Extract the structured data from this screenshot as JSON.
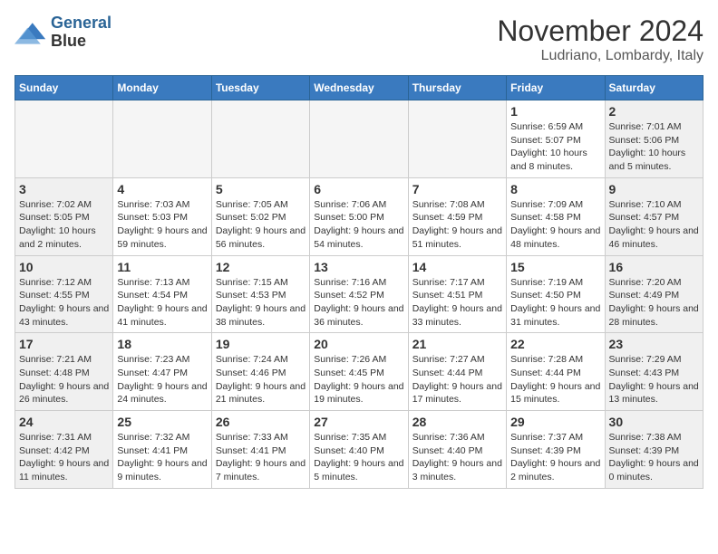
{
  "logo": {
    "line1": "General",
    "line2": "Blue"
  },
  "header": {
    "month": "November 2024",
    "location": "Ludriano, Lombardy, Italy"
  },
  "weekdays": [
    "Sunday",
    "Monday",
    "Tuesday",
    "Wednesday",
    "Thursday",
    "Friday",
    "Saturday"
  ],
  "weeks": [
    [
      {
        "day": "",
        "empty": true
      },
      {
        "day": "",
        "empty": true
      },
      {
        "day": "",
        "empty": true
      },
      {
        "day": "",
        "empty": true
      },
      {
        "day": "",
        "empty": true
      },
      {
        "day": "1",
        "sunrise": "Sunrise: 6:59 AM",
        "sunset": "Sunset: 5:07 PM",
        "daylight": "Daylight: 10 hours and 8 minutes."
      },
      {
        "day": "2",
        "sunrise": "Sunrise: 7:01 AM",
        "sunset": "Sunset: 5:06 PM",
        "daylight": "Daylight: 10 hours and 5 minutes."
      }
    ],
    [
      {
        "day": "3",
        "sunrise": "Sunrise: 7:02 AM",
        "sunset": "Sunset: 5:05 PM",
        "daylight": "Daylight: 10 hours and 2 minutes."
      },
      {
        "day": "4",
        "sunrise": "Sunrise: 7:03 AM",
        "sunset": "Sunset: 5:03 PM",
        "daylight": "Daylight: 9 hours and 59 minutes."
      },
      {
        "day": "5",
        "sunrise": "Sunrise: 7:05 AM",
        "sunset": "Sunset: 5:02 PM",
        "daylight": "Daylight: 9 hours and 56 minutes."
      },
      {
        "day": "6",
        "sunrise": "Sunrise: 7:06 AM",
        "sunset": "Sunset: 5:00 PM",
        "daylight": "Daylight: 9 hours and 54 minutes."
      },
      {
        "day": "7",
        "sunrise": "Sunrise: 7:08 AM",
        "sunset": "Sunset: 4:59 PM",
        "daylight": "Daylight: 9 hours and 51 minutes."
      },
      {
        "day": "8",
        "sunrise": "Sunrise: 7:09 AM",
        "sunset": "Sunset: 4:58 PM",
        "daylight": "Daylight: 9 hours and 48 minutes."
      },
      {
        "day": "9",
        "sunrise": "Sunrise: 7:10 AM",
        "sunset": "Sunset: 4:57 PM",
        "daylight": "Daylight: 9 hours and 46 minutes."
      }
    ],
    [
      {
        "day": "10",
        "sunrise": "Sunrise: 7:12 AM",
        "sunset": "Sunset: 4:55 PM",
        "daylight": "Daylight: 9 hours and 43 minutes."
      },
      {
        "day": "11",
        "sunrise": "Sunrise: 7:13 AM",
        "sunset": "Sunset: 4:54 PM",
        "daylight": "Daylight: 9 hours and 41 minutes."
      },
      {
        "day": "12",
        "sunrise": "Sunrise: 7:15 AM",
        "sunset": "Sunset: 4:53 PM",
        "daylight": "Daylight: 9 hours and 38 minutes."
      },
      {
        "day": "13",
        "sunrise": "Sunrise: 7:16 AM",
        "sunset": "Sunset: 4:52 PM",
        "daylight": "Daylight: 9 hours and 36 minutes."
      },
      {
        "day": "14",
        "sunrise": "Sunrise: 7:17 AM",
        "sunset": "Sunset: 4:51 PM",
        "daylight": "Daylight: 9 hours and 33 minutes."
      },
      {
        "day": "15",
        "sunrise": "Sunrise: 7:19 AM",
        "sunset": "Sunset: 4:50 PM",
        "daylight": "Daylight: 9 hours and 31 minutes."
      },
      {
        "day": "16",
        "sunrise": "Sunrise: 7:20 AM",
        "sunset": "Sunset: 4:49 PM",
        "daylight": "Daylight: 9 hours and 28 minutes."
      }
    ],
    [
      {
        "day": "17",
        "sunrise": "Sunrise: 7:21 AM",
        "sunset": "Sunset: 4:48 PM",
        "daylight": "Daylight: 9 hours and 26 minutes."
      },
      {
        "day": "18",
        "sunrise": "Sunrise: 7:23 AM",
        "sunset": "Sunset: 4:47 PM",
        "daylight": "Daylight: 9 hours and 24 minutes."
      },
      {
        "day": "19",
        "sunrise": "Sunrise: 7:24 AM",
        "sunset": "Sunset: 4:46 PM",
        "daylight": "Daylight: 9 hours and 21 minutes."
      },
      {
        "day": "20",
        "sunrise": "Sunrise: 7:26 AM",
        "sunset": "Sunset: 4:45 PM",
        "daylight": "Daylight: 9 hours and 19 minutes."
      },
      {
        "day": "21",
        "sunrise": "Sunrise: 7:27 AM",
        "sunset": "Sunset: 4:44 PM",
        "daylight": "Daylight: 9 hours and 17 minutes."
      },
      {
        "day": "22",
        "sunrise": "Sunrise: 7:28 AM",
        "sunset": "Sunset: 4:44 PM",
        "daylight": "Daylight: 9 hours and 15 minutes."
      },
      {
        "day": "23",
        "sunrise": "Sunrise: 7:29 AM",
        "sunset": "Sunset: 4:43 PM",
        "daylight": "Daylight: 9 hours and 13 minutes."
      }
    ],
    [
      {
        "day": "24",
        "sunrise": "Sunrise: 7:31 AM",
        "sunset": "Sunset: 4:42 PM",
        "daylight": "Daylight: 9 hours and 11 minutes."
      },
      {
        "day": "25",
        "sunrise": "Sunrise: 7:32 AM",
        "sunset": "Sunset: 4:41 PM",
        "daylight": "Daylight: 9 hours and 9 minutes."
      },
      {
        "day": "26",
        "sunrise": "Sunrise: 7:33 AM",
        "sunset": "Sunset: 4:41 PM",
        "daylight": "Daylight: 9 hours and 7 minutes."
      },
      {
        "day": "27",
        "sunrise": "Sunrise: 7:35 AM",
        "sunset": "Sunset: 4:40 PM",
        "daylight": "Daylight: 9 hours and 5 minutes."
      },
      {
        "day": "28",
        "sunrise": "Sunrise: 7:36 AM",
        "sunset": "Sunset: 4:40 PM",
        "daylight": "Daylight: 9 hours and 3 minutes."
      },
      {
        "day": "29",
        "sunrise": "Sunrise: 7:37 AM",
        "sunset": "Sunset: 4:39 PM",
        "daylight": "Daylight: 9 hours and 2 minutes."
      },
      {
        "day": "30",
        "sunrise": "Sunrise: 7:38 AM",
        "sunset": "Sunset: 4:39 PM",
        "daylight": "Daylight: 9 hours and 0 minutes."
      }
    ]
  ]
}
